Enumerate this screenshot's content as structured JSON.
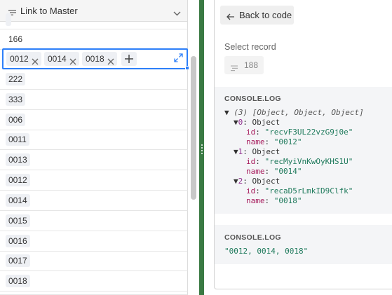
{
  "grid": {
    "column_title": "Link to Master",
    "rows": [
      "166",
      "222",
      "333",
      "006",
      "0011",
      "0013",
      "0012",
      "0014",
      "0015",
      "0016",
      "0017",
      "0018"
    ],
    "active_cell": {
      "chips": [
        "0012",
        "0014",
        "0018"
      ],
      "add_symbol": "+"
    }
  },
  "panel": {
    "back_label": "Back to code",
    "select_label": "Select record",
    "record_value": "188",
    "console1": {
      "title": "CONSOLE.LOG",
      "summary_count": "(3)",
      "summary_text": "[Object, Object, Object]",
      "items": [
        {
          "index": "0",
          "type": "Object",
          "id": "\"recvF3UL22vzG9j0e\"",
          "name": "\"0012\""
        },
        {
          "index": "1",
          "type": "Object",
          "id": "\"recMyiVnKwOyKHS1U\"",
          "name": "\"0014\""
        },
        {
          "index": "2",
          "type": "Object",
          "id": "\"recaD5rLmkID9Clfk\"",
          "name": "\"0018\""
        }
      ],
      "id_key": "id",
      "name_key": "name"
    },
    "console2": {
      "title": "CONSOLE.LOG",
      "output": "\"0012, 0014, 0018\""
    }
  },
  "colors": {
    "accent": "#2d7ff9",
    "divider": "#3a7a43",
    "string": "#1f7a5c",
    "key": "#a71d5d"
  }
}
